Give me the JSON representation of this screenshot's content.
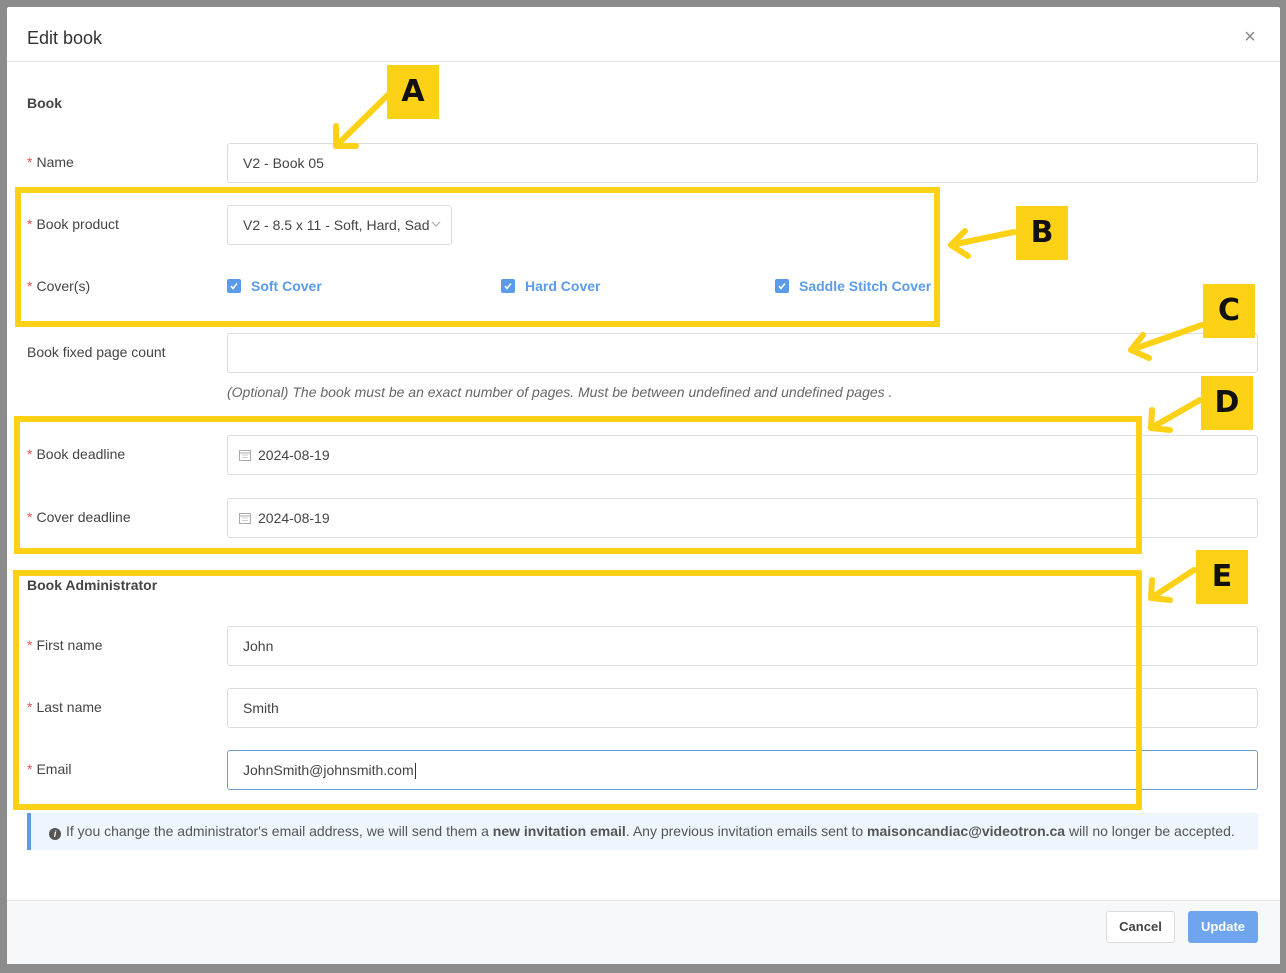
{
  "modal": {
    "title": "Edit book",
    "close_icon": "×"
  },
  "book": {
    "section_title": "Book",
    "name": {
      "label": "Name",
      "value": "V2 - Book 05"
    },
    "product": {
      "label": "Book product",
      "value": "V2 - 8.5 x 11 - Soft, Hard, Sad"
    },
    "covers": {
      "label": "Cover(s)",
      "options": [
        {
          "label": "Soft Cover",
          "checked": true
        },
        {
          "label": "Hard Cover",
          "checked": true
        },
        {
          "label": "Saddle Stitch Cover",
          "checked": true
        }
      ]
    },
    "fixed_page_count": {
      "label": "Book fixed page count",
      "value": "",
      "hint": "(Optional) The book must be an exact number of pages. Must be between undefined and undefined pages ."
    },
    "book_deadline": {
      "label": "Book deadline",
      "value": "2024-08-19"
    },
    "cover_deadline": {
      "label": "Cover deadline",
      "value": "2024-08-19"
    }
  },
  "admin": {
    "section_title": "Book Administrator",
    "first_name": {
      "label": "First name",
      "value": "John"
    },
    "last_name": {
      "label": "Last name",
      "value": "Smith"
    },
    "email": {
      "label": "Email",
      "value": "JohnSmith@johnsmith.com"
    }
  },
  "info": {
    "icon": "i",
    "text_1": "If you change the administrator's email address, we will send them a ",
    "bold_1": "new invitation email",
    "text_2": ". Any previous invitation emails sent to ",
    "bold_2": "maisoncandiac@videotron.ca",
    "text_3": " will no longer be accepted."
  },
  "footer": {
    "cancel": "Cancel",
    "update": "Update"
  },
  "annotations": {
    "tags": [
      "A",
      "B",
      "C",
      "D",
      "E"
    ],
    "highlight_color": "#fcd116"
  },
  "colors": {
    "accent": "#5b9bea",
    "required": "#e25555",
    "annotation": "#fcd116"
  }
}
